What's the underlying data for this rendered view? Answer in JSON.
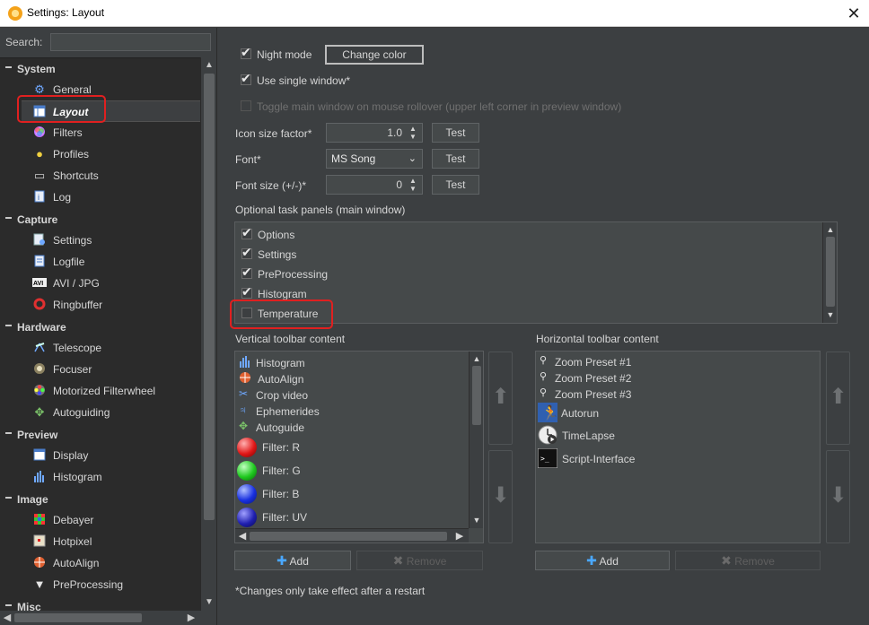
{
  "window": {
    "title": "Settings: Layout"
  },
  "sidebar": {
    "search_label": "Search:",
    "search_value": "",
    "groups": [
      {
        "label": "System",
        "items": [
          {
            "label": "General",
            "icon": "gear-icon"
          },
          {
            "label": "Layout",
            "icon": "layout-icon",
            "selected": true
          },
          {
            "label": "Filters",
            "icon": "color-wheel-icon"
          },
          {
            "label": "Profiles",
            "icon": "profile-bulb-icon"
          },
          {
            "label": "Shortcuts",
            "icon": "keyboard-icon"
          },
          {
            "label": "Log",
            "icon": "log-icon"
          }
        ]
      },
      {
        "label": "Capture",
        "items": [
          {
            "label": "Settings",
            "icon": "capture-settings-icon"
          },
          {
            "label": "Logfile",
            "icon": "logfile-icon"
          },
          {
            "label": "AVI / JPG",
            "icon": "avi-icon"
          },
          {
            "label": "Ringbuffer",
            "icon": "ringbuffer-icon"
          }
        ]
      },
      {
        "label": "Hardware",
        "items": [
          {
            "label": "Telescope",
            "icon": "telescope-icon"
          },
          {
            "label": "Focuser",
            "icon": "focuser-icon"
          },
          {
            "label": "Motorized Filterwheel",
            "icon": "filterwheel-icon"
          },
          {
            "label": "Autoguiding",
            "icon": "autoguiding-icon"
          }
        ]
      },
      {
        "label": "Preview",
        "items": [
          {
            "label": "Display",
            "icon": "display-icon"
          },
          {
            "label": "Histogram",
            "icon": "histogram-icon"
          }
        ]
      },
      {
        "label": "Image",
        "items": [
          {
            "label": "Debayer",
            "icon": "debayer-icon"
          },
          {
            "label": "Hotpixel",
            "icon": "hotpixel-icon"
          },
          {
            "label": "AutoAlign",
            "icon": "autoalign-icon"
          },
          {
            "label": "PreProcessing",
            "icon": "preprocessing-icon"
          }
        ]
      },
      {
        "label": "Misc",
        "items": []
      }
    ]
  },
  "layout": {
    "night_mode": {
      "label": "Night mode",
      "checked": true
    },
    "change_color_label": "Change color",
    "single_window": {
      "label": "Use single window*",
      "checked": true
    },
    "toggle_main": {
      "label": "Toggle main window on mouse rollover (upper left corner in preview window)",
      "checked": false
    },
    "icon_size": {
      "label": "Icon size factor*",
      "value": "1.0"
    },
    "font": {
      "label": "Font*",
      "value": "MS Song"
    },
    "font_size": {
      "label": "Font size (+/-)*",
      "value": "0"
    },
    "test_label": "Test",
    "optional_panels_label": "Optional task panels (main window)",
    "optional_panels": [
      {
        "label": "Options",
        "checked": true
      },
      {
        "label": "Settings",
        "checked": true
      },
      {
        "label": "PreProcessing",
        "checked": true
      },
      {
        "label": "Histogram",
        "checked": true
      },
      {
        "label": "Temperature",
        "checked": false
      }
    ],
    "vertical_toolbar_label": "Vertical toolbar content",
    "vertical_items": [
      {
        "label": "Histogram",
        "icon": "histogram-icon"
      },
      {
        "label": "AutoAlign",
        "icon": "autoalign-icon"
      },
      {
        "label": "Crop video",
        "icon": "crop-icon"
      },
      {
        "label": "Ephemerides",
        "icon": "ephemerides-icon"
      },
      {
        "label": "Autoguide",
        "icon": "autoguide-icon"
      },
      {
        "label": "Filter: R",
        "icon": "red-ball-icon",
        "color": "#e01818"
      },
      {
        "label": "Filter: G",
        "icon": "green-ball-icon",
        "color": "#1ec81e"
      },
      {
        "label": "Filter: B",
        "icon": "blue-ball-icon",
        "color": "#1830e0"
      },
      {
        "label": "Filter: UV",
        "icon": "uv-ball-icon",
        "color": "#2020b0"
      }
    ],
    "horizontal_toolbar_label": "Horizontal toolbar content",
    "horizontal_items": [
      {
        "label": "Zoom Preset #1",
        "icon": "zoom-preset-icon"
      },
      {
        "label": "Zoom Preset #2",
        "icon": "zoom-preset-icon"
      },
      {
        "label": "Zoom Preset #3",
        "icon": "zoom-preset-icon"
      },
      {
        "label": "Autorun",
        "icon": "autorun-icon"
      },
      {
        "label": "TimeLapse",
        "icon": "timelapse-icon"
      },
      {
        "label": "Script-Interface",
        "icon": "script-icon"
      }
    ],
    "add_label": "Add",
    "remove_label": "Remove",
    "footnote": "*Changes only take effect after a restart"
  }
}
